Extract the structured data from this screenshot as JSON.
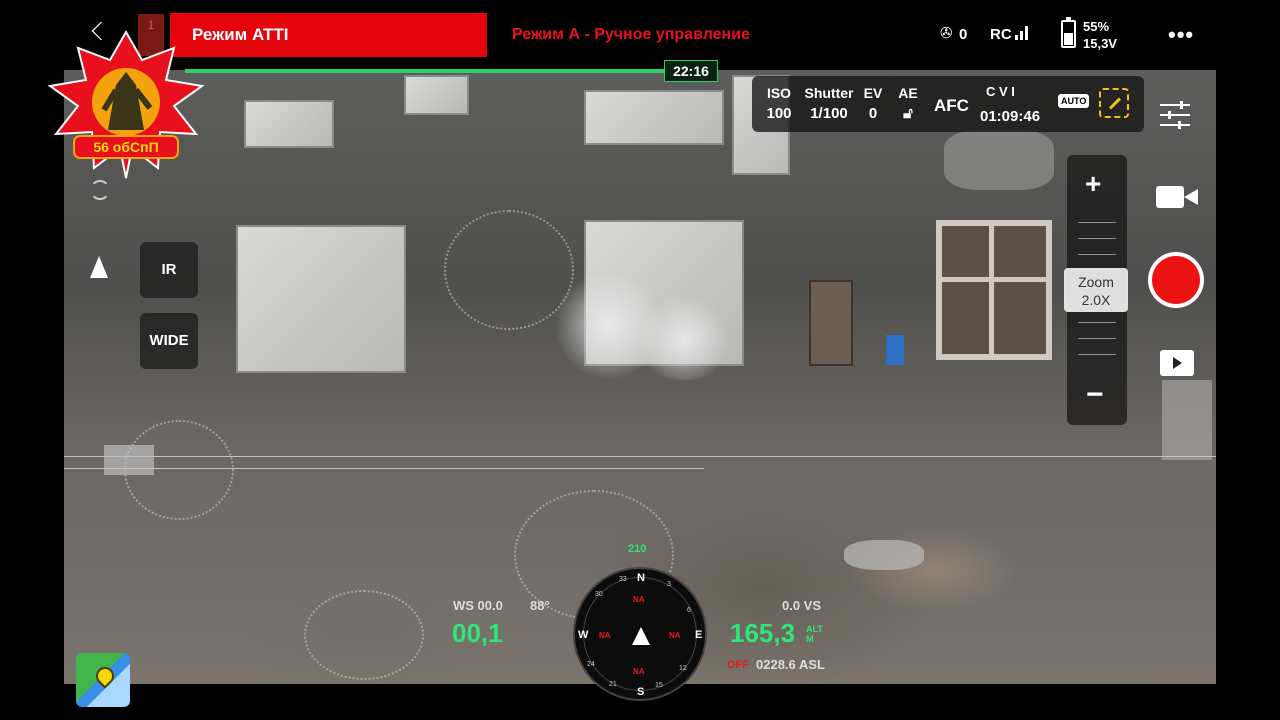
{
  "topbar": {
    "mode": "Режим ATTI",
    "mode_description": "Режим А - Ручное управление",
    "badge_number": "1",
    "propeller_count": "0",
    "rc_label": "RC",
    "battery_percent": "55%",
    "battery_voltage": "15,3V",
    "flight_time": "22:16"
  },
  "emblem": {
    "text": "56 обСпП"
  },
  "camera": {
    "iso_label": "ISO",
    "iso": "100",
    "shutter_label": "Shutter",
    "shutter": "1/100",
    "ev_label": "EV",
    "ev": "0",
    "ae_label": "AE",
    "focus": "AFC",
    "storage": "C V I",
    "record_time": "01:09:46",
    "auto_label": "AUTO"
  },
  "side": {
    "ir_label": "IR",
    "wide_label": "WIDE"
  },
  "zoom": {
    "label": "Zoom",
    "value": "2.0X",
    "plus": "+",
    "minus": "−"
  },
  "telemetry": {
    "ws": "WS 00.0",
    "angle": "88°",
    "horizontal_speed": "00,1",
    "vs": "0.0  VS",
    "altitude": "165,3",
    "alt_unit": "ALT",
    "alt_unit2": "M",
    "off": "OFF",
    "asl": "0228.6 ASL",
    "top_mark": "210"
  },
  "compass": {
    "n": "N",
    "e": "E",
    "s": "S",
    "w": "W",
    "na": "NA",
    "deg_33": "33",
    "deg_30": "30",
    "deg_24": "24",
    "deg_21": "21",
    "deg_15": "15",
    "deg_12": "12",
    "deg_6": "6",
    "deg_3": "3"
  },
  "icons": {
    "back": "back-arrow-icon",
    "propeller": "propeller-icon",
    "battery": "battery-icon",
    "more": "more-icon",
    "link": "link-icon",
    "settings": "sliders-icon",
    "record": "record-icon",
    "video": "video-camera-icon",
    "playback": "playback-icon",
    "map": "map-icon",
    "aircraft": "aircraft-arrow-icon"
  },
  "colors": {
    "mode_red": "#e4040b",
    "telemetry_green": "#2ee67c",
    "record_red": "#ee1111",
    "link_yellow": "#f2c21b"
  }
}
